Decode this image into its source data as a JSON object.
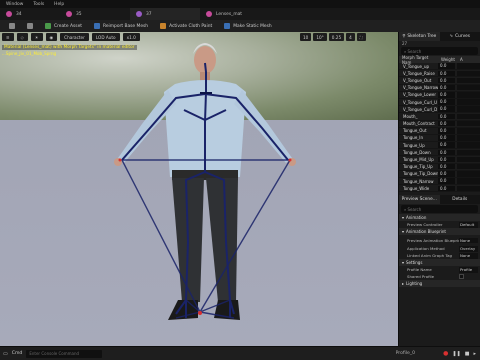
{
  "menubar": {
    "items": [
      "Window",
      "Tools",
      "Help"
    ]
  },
  "asset_tabs": [
    {
      "label": "34",
      "icon": "mesh-icon"
    },
    {
      "label": "35",
      "icon": "mesh-icon"
    },
    {
      "label": "37",
      "icon": "skeleton-icon"
    },
    {
      "label": "Lenses_mat",
      "icon": "material-icon"
    }
  ],
  "toolbar": {
    "buttons": [
      "",
      "",
      "Create Asset",
      "Reimport Base Mesh",
      "Activate Cloth Paint",
      "Make Static Mesh"
    ]
  },
  "viewport": {
    "tools": [
      "Character",
      "LOD Auto",
      "x1.0"
    ],
    "right_tools": [
      "10",
      "10°",
      "0.25",
      "4"
    ],
    "message1": "Material (Lenses_mat) with Morph Targets\" in material editor",
    "message2": "...Spine_Jiv_01_Mob_Sprng"
  },
  "right_panel": {
    "tabs": [
      "Skeleton Tree",
      "Curves"
    ],
    "count": "27",
    "search_placeholder": "Search",
    "headers": {
      "name": "Morph Target Nam",
      "weight": "Weight",
      "auto": "A"
    },
    "morphs": [
      {
        "name": "V_Tongue_up",
        "weight": "0.0"
      },
      {
        "name": "V_Tongue_Raise",
        "weight": "0.0"
      },
      {
        "name": "V_Tongue_Out",
        "weight": "0.0"
      },
      {
        "name": "V_Tongue_Narrow",
        "weight": "0.0"
      },
      {
        "name": "V_Tongue_Lower",
        "weight": "0.0"
      },
      {
        "name": "V_Tongue_Curl_U",
        "weight": "0.0"
      },
      {
        "name": "V_Tongue_Curl_D",
        "weight": "0.0"
      },
      {
        "name": "Mouth_",
        "weight": "0.0"
      },
      {
        "name": "Mouth_Contract",
        "weight": "0.0"
      },
      {
        "name": "Tongue_Out",
        "weight": "0.0"
      },
      {
        "name": "Tongue_In",
        "weight": "0.0"
      },
      {
        "name": "Tongue_Up",
        "weight": "0.0"
      },
      {
        "name": "Tongue_Down",
        "weight": "0.0"
      },
      {
        "name": "Tongue_Mid_Up",
        "weight": "0.0"
      },
      {
        "name": "Tongue_Tip_Up",
        "weight": "0.0"
      },
      {
        "name": "Tongue_Tip_Down",
        "weight": "0.0"
      },
      {
        "name": "Tongue_Narrow",
        "weight": "0.0"
      },
      {
        "name": "Tongue_Wide",
        "weight": "0.0"
      }
    ],
    "bottom_tabs": [
      "Preview Scene...",
      "Details"
    ],
    "details_search": "Search",
    "sections": {
      "animation": "Animation",
      "blueprint": "Animation Blueprint",
      "settings": "Settings",
      "lighting": "Lighting"
    },
    "props": [
      {
        "label": "Preview Controller",
        "value": "Default"
      },
      {
        "label": "Preview Animation Blueprint",
        "value": "None"
      },
      {
        "label": "Application Method",
        "value": "Overlay"
      },
      {
        "label": "Linked Anim Graph Tag",
        "value": "None"
      },
      {
        "label": "Profile Name",
        "value": "Profile"
      },
      {
        "label": "Shared Profile",
        "value": ""
      }
    ],
    "profile_footer": "Profile_0"
  },
  "statusbar": {
    "cmd_label": "Cmd",
    "cmd_placeholder": "Enter Console Command"
  },
  "colors": {
    "accent": "#3b7fd6",
    "warning_text": "#ffee33",
    "bone": "#1a2368"
  }
}
